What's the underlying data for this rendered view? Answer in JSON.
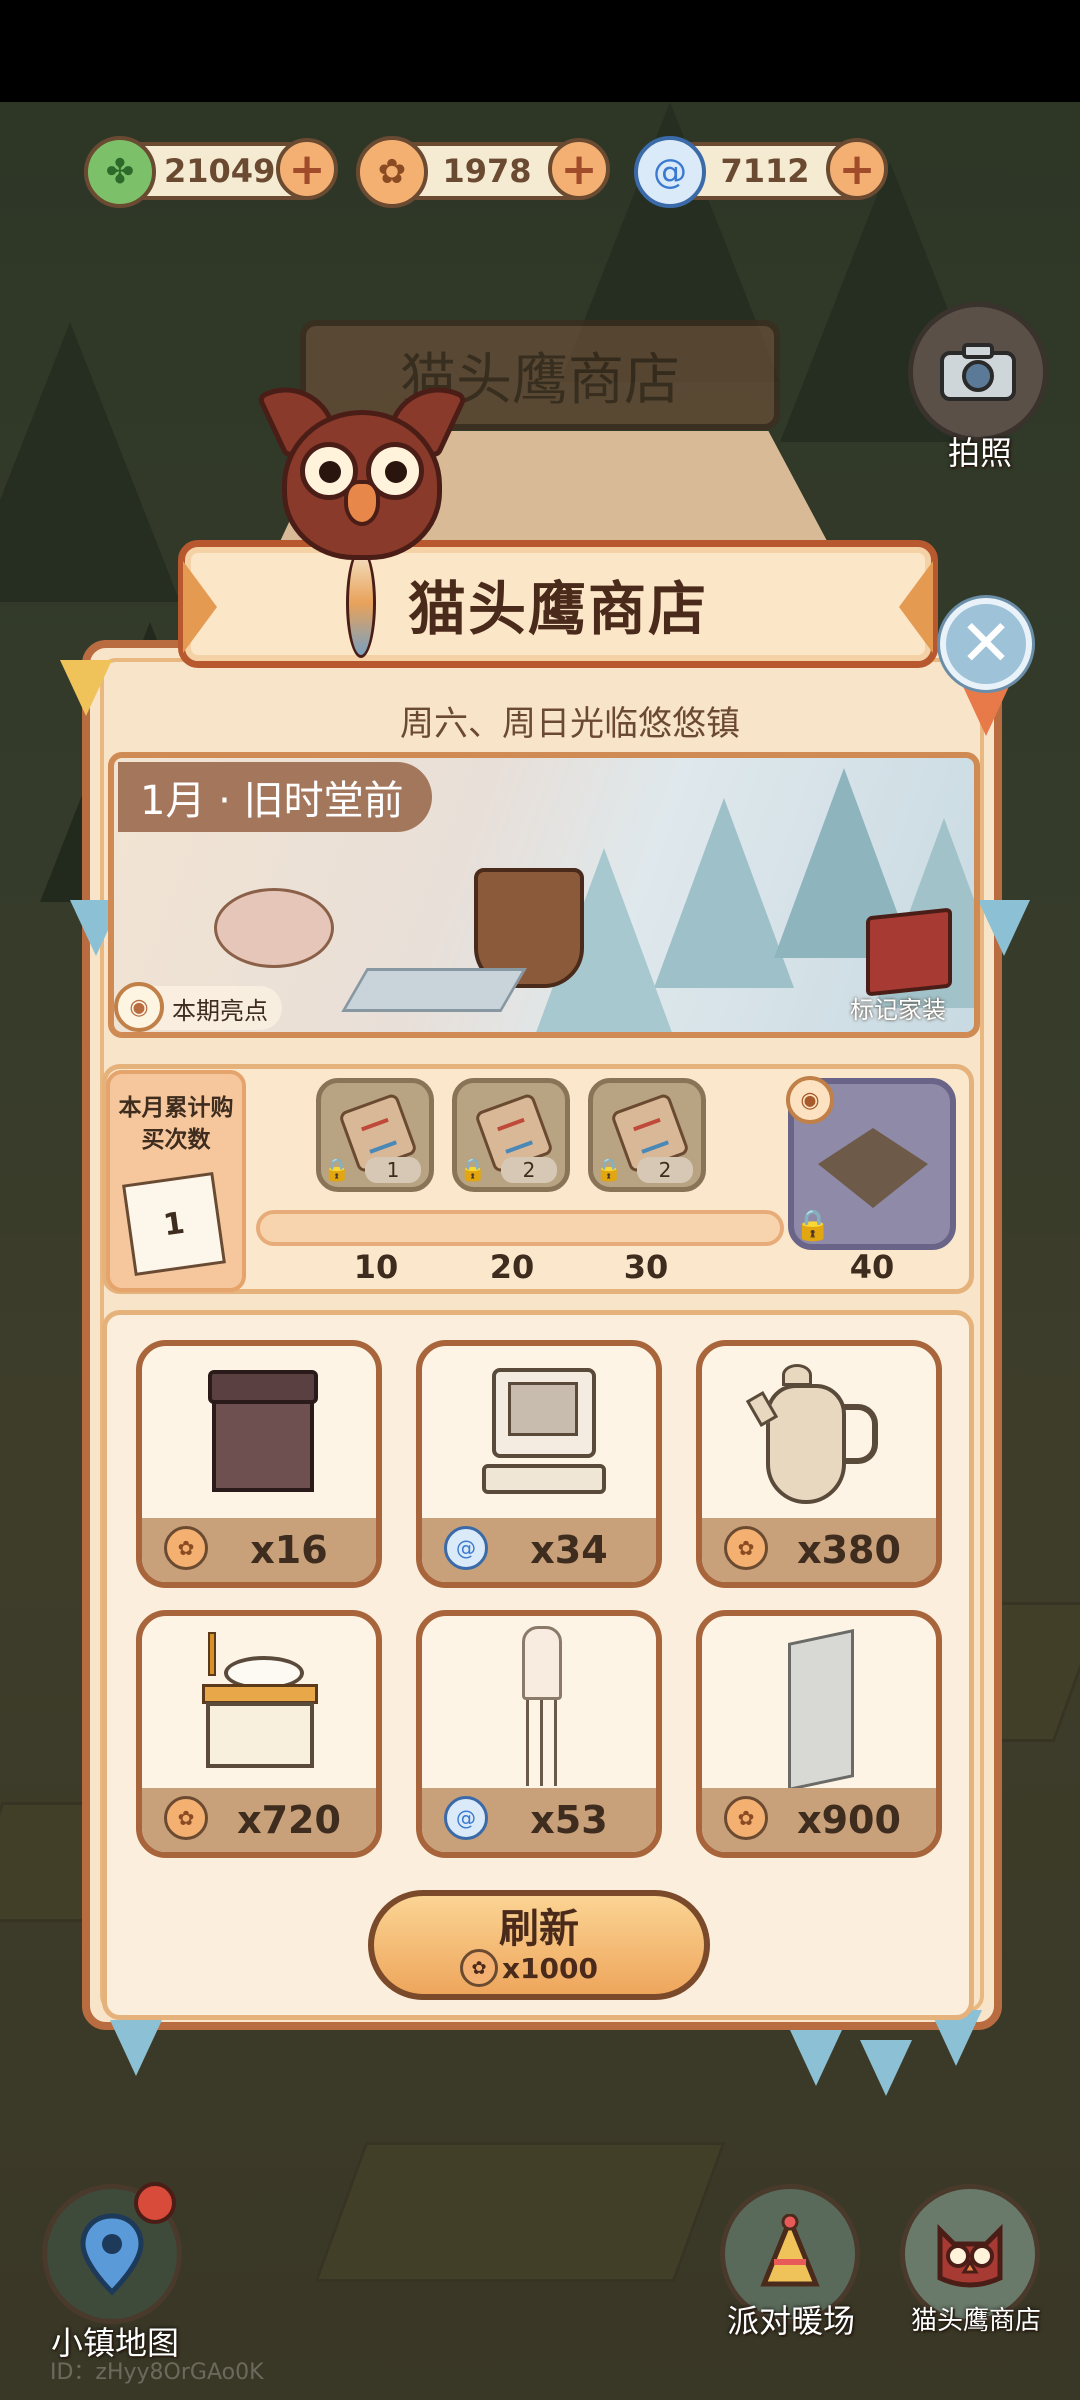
{
  "currencies": [
    {
      "name": "leaf",
      "icon": "clover-leaf-icon",
      "value": "21049",
      "color": "#7cc06a"
    },
    {
      "name": "coin",
      "icon": "gold-coin-icon",
      "value": "1978",
      "color": "#f4b071"
    },
    {
      "name": "gem",
      "icon": "blue-swirl-icon",
      "value": "7112",
      "color": "#4a8ed8"
    }
  ],
  "plus_label": "+",
  "camera": {
    "icon": "camera-icon",
    "label": "拍照"
  },
  "shop": {
    "title": "猫头鹰商店",
    "subtitle": "周六、周日光临悠悠镇",
    "close_label": "✕",
    "theme": {
      "label": "1月 · 旧时堂前",
      "highlight_label": "本期亮点",
      "mark_label": "标记家装"
    },
    "progress": {
      "label": "本月累计购买次数",
      "current": "1",
      "fill_fraction": 0.0,
      "milestones": [
        {
          "value": "10",
          "reward_qty": "1"
        },
        {
          "value": "20",
          "reward_qty": "2"
        },
        {
          "value": "30",
          "reward_qty": "2"
        },
        {
          "value": "40",
          "reward_qty": ""
        }
      ]
    },
    "items": [
      {
        "name": "dark-cabinet",
        "currency": "coin",
        "price": "x16"
      },
      {
        "name": "retro-computer",
        "currency": "gem",
        "price": "x34"
      },
      {
        "name": "coffee-pot",
        "currency": "coin",
        "price": "x380"
      },
      {
        "name": "wash-basin-cabinet",
        "currency": "coin",
        "price": "x720"
      },
      {
        "name": "floor-lamp",
        "currency": "gem",
        "price": "x53"
      },
      {
        "name": "wall-panel",
        "currency": "coin",
        "price": "x900"
      }
    ],
    "refresh": {
      "label": "刷新",
      "cost": "x1000"
    }
  },
  "background_sign": "猫头鹰商店",
  "bottom_nav": [
    {
      "icon": "map-pin-icon",
      "label": "小镇地图"
    },
    {
      "icon": "party-hat-icon",
      "label": "派对暖场"
    },
    {
      "icon": "owl-shop-icon",
      "label": "猫头鹰商店"
    }
  ],
  "user_id": "ID：zHyy8OrGAo0K"
}
